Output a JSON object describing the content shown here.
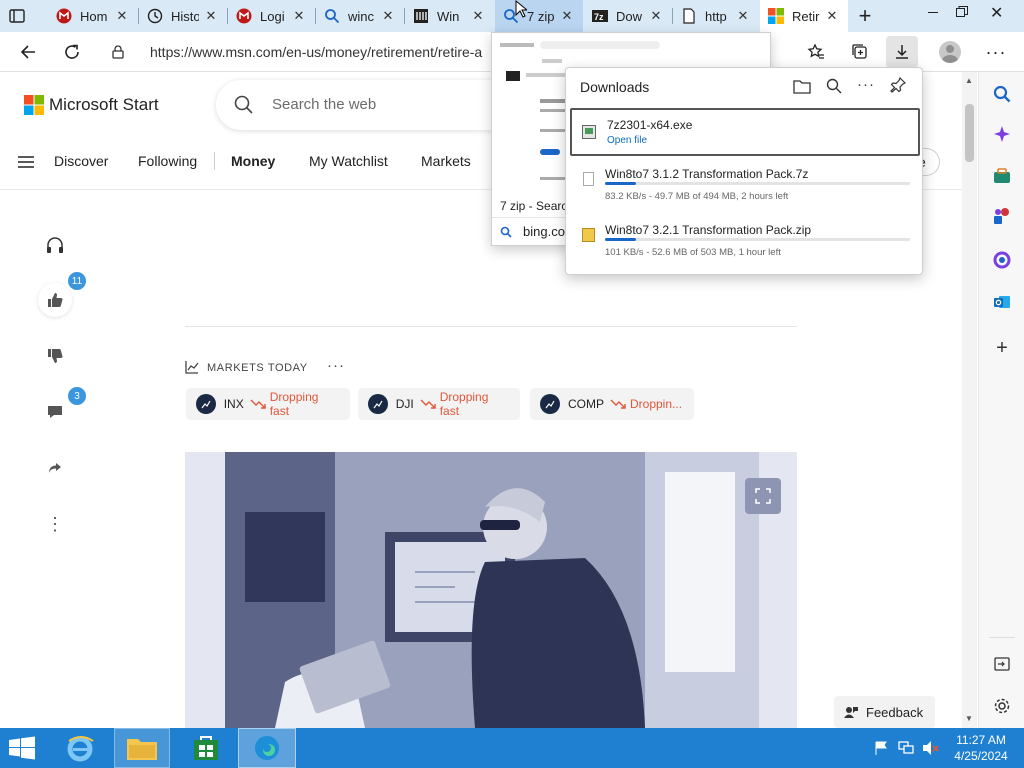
{
  "tabs": [
    {
      "title": "Hom",
      "icon": "mcafee-icon",
      "state": "normal"
    },
    {
      "title": "Histo",
      "icon": "history-icon",
      "state": "normal"
    },
    {
      "title": "Logi",
      "icon": "mcafee-icon",
      "state": "normal"
    },
    {
      "title": "winc",
      "icon": "search-icon",
      "state": "normal"
    },
    {
      "title": "Win",
      "icon": "library-icon",
      "state": "normal"
    },
    {
      "title": "7 zip",
      "icon": "search-icon",
      "state": "hover"
    },
    {
      "title": "Dow",
      "icon": "7zip-icon",
      "state": "normal"
    },
    {
      "title": "http",
      "icon": "page-icon",
      "state": "normal"
    },
    {
      "title": "Retir",
      "icon": "microsoft-icon",
      "state": "active"
    }
  ],
  "tab_close_glyph": "✕",
  "new_tab_glyph": "+",
  "address": {
    "url": "https://www.msn.com/en-us/money/retirement/retire-a"
  },
  "msn": {
    "brand": "Microsoft Start",
    "search_placeholder": "Search the web",
    "nav": [
      "Discover",
      "Following",
      "Money",
      "My Watchlist",
      "Markets"
    ],
    "nav_active": "Money",
    "partial_button": "e"
  },
  "rail": {
    "like_count": "11",
    "comment_count": "3"
  },
  "markets": {
    "label": "MARKETS TODAY",
    "chips": [
      {
        "symbol": "INX",
        "status": "Dropping fast"
      },
      {
        "symbol": "DJI",
        "status": "Dropping fast"
      },
      {
        "symbol": "COMP",
        "status": "Droppin..."
      }
    ]
  },
  "feedback_label": "Feedback",
  "downloads": {
    "title": "Downloads",
    "items": [
      {
        "name": "7z2301-x64.exe",
        "action": "Open file"
      },
      {
        "name": "Win8to7 3.1.2 Transformation Pack.7z",
        "status": "83.2 KB/s - 49.7 MB of 494 MB, 2 hours left",
        "progress": 0.1
      },
      {
        "name": "Win8to7 3.2.1 Transformation Pack.zip",
        "status": "101 KB/s - 52.6 MB of 503 MB, 1 hour left",
        "progress": 0.1
      }
    ]
  },
  "tab_preview": {
    "title": "7 zip - Searc",
    "domain": "bing.co"
  },
  "taskbar": {
    "time": "11:27 AM",
    "date": "4/25/2024"
  },
  "colors": {
    "accent": "#0f6cbd",
    "tabstrip": "#dae9f6",
    "taskbar": "#1f7fd0",
    "drop": "#e0573a"
  }
}
